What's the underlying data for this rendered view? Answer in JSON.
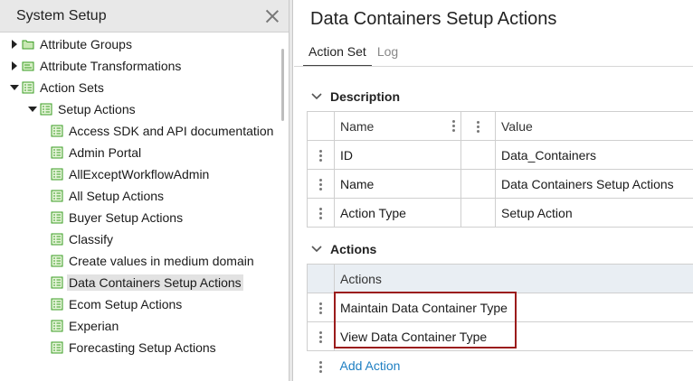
{
  "left_panel": {
    "title": "System Setup",
    "tree": [
      {
        "label": "Attribute Groups",
        "level": 0,
        "toggle": "collapsed",
        "icon": "folder-icon"
      },
      {
        "label": "Attribute Transformations",
        "level": 0,
        "toggle": "collapsed",
        "icon": "transform-icon"
      },
      {
        "label": "Action Sets",
        "level": 0,
        "toggle": "expanded",
        "icon": "action-set-icon"
      },
      {
        "label": "Setup Actions",
        "level": 1,
        "toggle": "expanded",
        "icon": "action-set-icon"
      },
      {
        "label": "Access SDK and API documentation",
        "level": 2,
        "toggle": "none",
        "icon": "action-set-icon"
      },
      {
        "label": "Admin Portal",
        "level": 2,
        "toggle": "none",
        "icon": "action-set-icon"
      },
      {
        "label": "AllExceptWorkflowAdmin",
        "level": 2,
        "toggle": "none",
        "icon": "action-set-icon"
      },
      {
        "label": "All Setup Actions",
        "level": 2,
        "toggle": "none",
        "icon": "action-set-icon"
      },
      {
        "label": "Buyer Setup Actions",
        "level": 2,
        "toggle": "none",
        "icon": "action-set-icon"
      },
      {
        "label": "Classify",
        "level": 2,
        "toggle": "none",
        "icon": "action-set-icon"
      },
      {
        "label": "Create values in medium domain",
        "level": 2,
        "toggle": "none",
        "icon": "action-set-icon"
      },
      {
        "label": "Data Containers Setup Actions",
        "level": 2,
        "toggle": "none",
        "icon": "action-set-icon",
        "selected": true
      },
      {
        "label": "Ecom Setup Actions",
        "level": 2,
        "toggle": "none",
        "icon": "action-set-icon"
      },
      {
        "label": "Experian",
        "level": 2,
        "toggle": "none",
        "icon": "action-set-icon"
      },
      {
        "label": "Forecasting Setup Actions",
        "level": 2,
        "toggle": "none",
        "icon": "action-set-icon"
      }
    ]
  },
  "main": {
    "title": "Data Containers Setup Actions",
    "tabs": [
      {
        "label": "Action Set",
        "active": true
      },
      {
        "label": "Log",
        "active": false
      }
    ],
    "description": {
      "heading": "Description",
      "columns": [
        "Name",
        "Value"
      ],
      "rows": [
        {
          "name": "ID",
          "value": "Data_Containers"
        },
        {
          "name": "Name",
          "value": "Data Containers Setup Actions"
        },
        {
          "name": "Action Type",
          "value": "Setup Action"
        }
      ]
    },
    "actions": {
      "heading": "Actions",
      "column": "Actions",
      "rows": [
        "Maintain Data Container Type",
        "View Data Container Type"
      ],
      "add_label": "Add Action"
    }
  },
  "colors": {
    "accent_link": "#1e7fc2",
    "highlight_border": "#9b1b1b",
    "icon_green": "#3a9d23"
  }
}
